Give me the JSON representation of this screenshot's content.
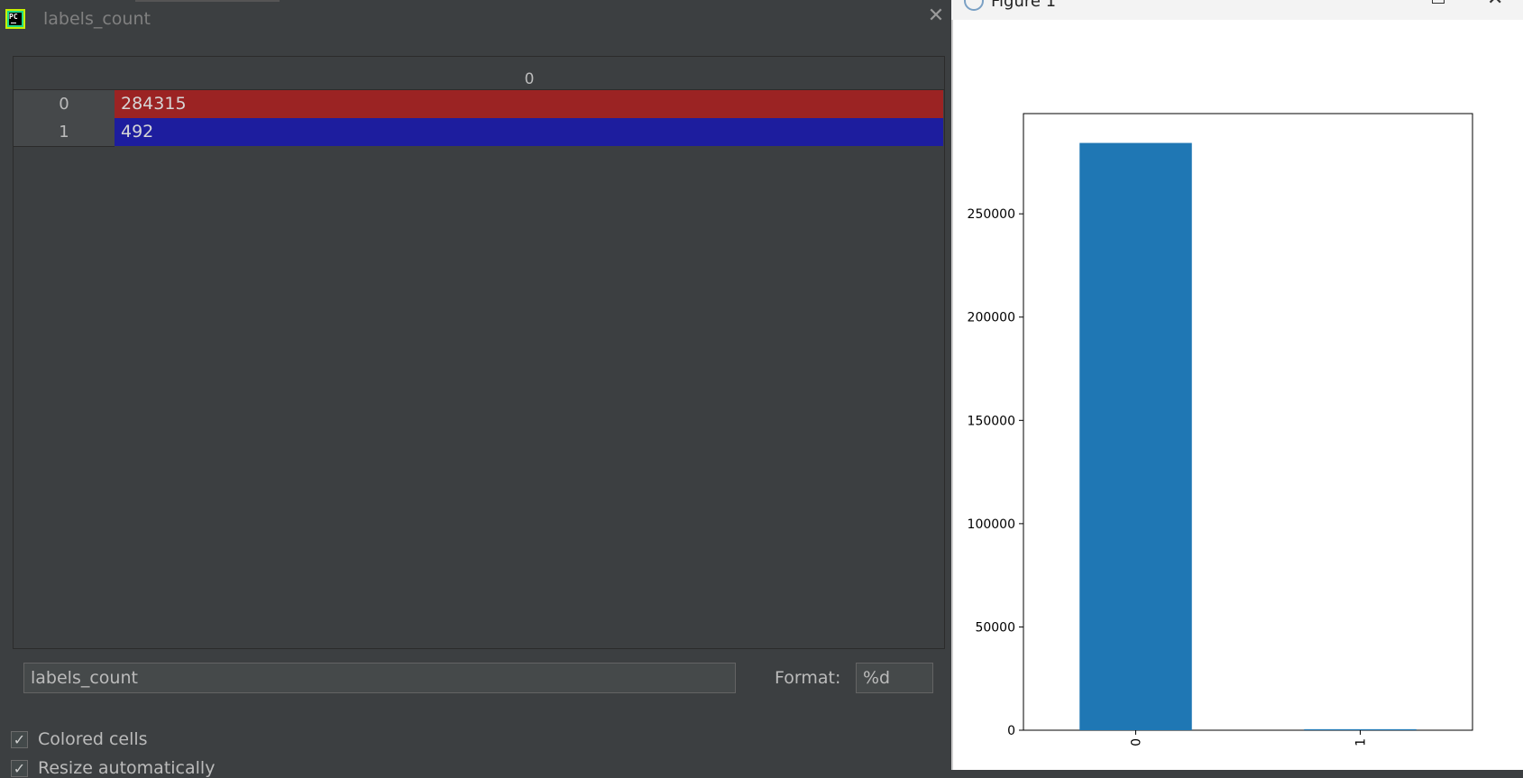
{
  "dialog": {
    "title": "labels_count",
    "close_icon": "close-icon",
    "app_icon_text": "PC",
    "column_header": "0",
    "rows": [
      {
        "index": "0",
        "value": "284315",
        "color": "#9b2323"
      },
      {
        "index": "1",
        "value": "492",
        "color": "#1d1d9e"
      }
    ],
    "expression": "labels_count",
    "format_label": "Format:",
    "format_value": "%d",
    "colored_cells_label": "Colored cells",
    "colored_cells_checked": true,
    "resize_label": "Resize automatically",
    "resize_checked": true
  },
  "figure": {
    "title": "Figure 1"
  },
  "chart_data": {
    "type": "bar",
    "categories": [
      "0",
      "1"
    ],
    "values": [
      284315,
      492
    ],
    "bar_color": "#1f77b4",
    "title": "",
    "xlabel": "",
    "ylabel": "",
    "ylim": [
      0,
      298526
    ],
    "yticks": [
      0,
      50000,
      100000,
      150000,
      200000,
      250000
    ],
    "xtick_rotation": "vertical",
    "grid": false,
    "legend": "none"
  }
}
